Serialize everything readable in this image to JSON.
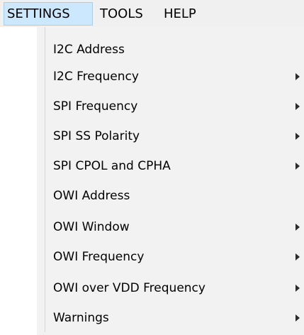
{
  "menubar": {
    "items": [
      {
        "label": "SETTINGS"
      },
      {
        "label": "TOOLS"
      },
      {
        "label": "HELP"
      }
    ]
  },
  "dropdown": {
    "items": [
      {
        "label": "I2C Address",
        "has_submenu": false
      },
      {
        "label": "I2C Frequency",
        "has_submenu": true
      },
      {
        "label": "SPI Frequency",
        "has_submenu": true
      },
      {
        "label": "SPI SS Polarity",
        "has_submenu": true
      },
      {
        "label": "SPI CPOL and CPHA",
        "has_submenu": true
      },
      {
        "label": "OWI Address",
        "has_submenu": false
      },
      {
        "label": "OWI Window",
        "has_submenu": true
      },
      {
        "label": "OWI Frequency",
        "has_submenu": true
      },
      {
        "label": "OWI over VDD Frequency",
        "has_submenu": true
      },
      {
        "label": "Warnings",
        "has_submenu": true
      }
    ]
  },
  "colors": {
    "menubar_bg": "#f0f0f0",
    "active_bg": "#cce8ff",
    "active_border": "#99d1ff",
    "dropdown_bg": "#f2f2f2",
    "separator": "#d7d7d7"
  }
}
